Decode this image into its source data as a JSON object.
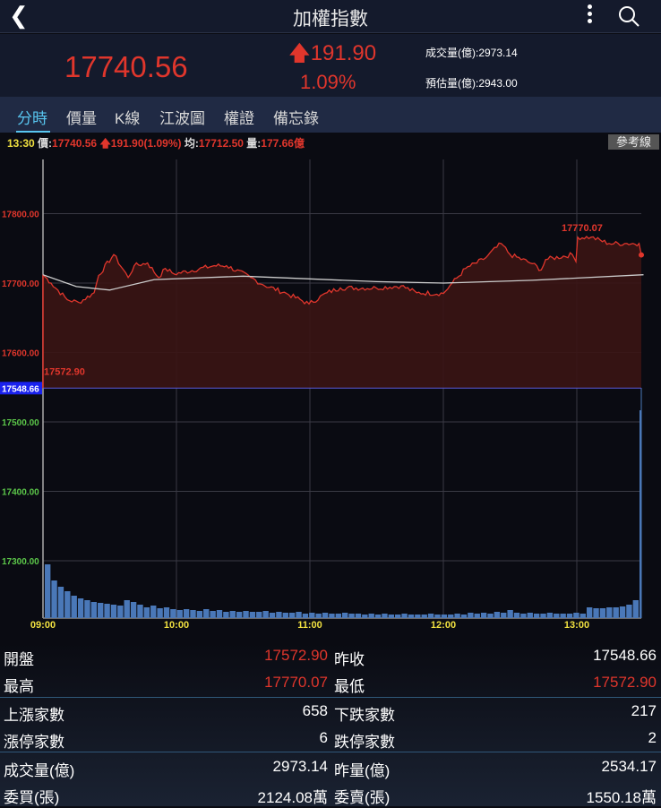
{
  "header": {
    "title": "加權指數",
    "back_icon": "chevron-left",
    "menu_icon": "more-vertical",
    "search_icon": "search"
  },
  "quote": {
    "price": "17740.56",
    "change": "191.90",
    "change_pct": "1.09%",
    "volume_label": "成交量(億):2973.14",
    "est_volume_label": "預估量(億):2943.00"
  },
  "tabs": [
    {
      "label": "分時",
      "active": true
    },
    {
      "label": "價量"
    },
    {
      "label": "K線"
    },
    {
      "label": "江波圖"
    },
    {
      "label": "權證"
    },
    {
      "label": "備忘錄"
    }
  ],
  "info": {
    "time": "13:30",
    "price_label": "價:",
    "price": "17740.56",
    "change": "191.90(1.09%)",
    "avg_label": "均:",
    "avg": "17712.50",
    "vol_label": "量:",
    "vol": "177.66億"
  },
  "ref_button": "參考線",
  "chart_data": {
    "type": "line",
    "prev_close": 17548.66,
    "prev_close_label": "17548.66",
    "high_label": "17770.07",
    "low_label": "17572.90",
    "y_ticks_upper": [
      "17800.00",
      "17700.00",
      "17600.00"
    ],
    "y_ticks_lower": [
      "17500.00",
      "17400.00",
      "17300.00"
    ],
    "x_ticks": [
      "09:00",
      "10:00",
      "11:00",
      "12:00",
      "13:00"
    ],
    "x_range_minutes": [
      0,
      270
    ],
    "price_series": [
      [
        0,
        17712
      ],
      [
        3.6,
        17700
      ],
      [
        10.9,
        17676
      ],
      [
        16.1,
        17672
      ],
      [
        23,
        17686
      ],
      [
        25,
        17711
      ],
      [
        31.8,
        17741
      ],
      [
        38.3,
        17708
      ],
      [
        41,
        17725
      ],
      [
        47,
        17729
      ],
      [
        52,
        17708
      ],
      [
        55,
        17721
      ],
      [
        59,
        17713
      ],
      [
        77,
        17725
      ],
      [
        82.5,
        17725
      ],
      [
        93.4,
        17708
      ],
      [
        98.7,
        17698
      ],
      [
        109.5,
        17685
      ],
      [
        119.6,
        17670
      ],
      [
        127.7,
        17686
      ],
      [
        133.7,
        17693
      ],
      [
        149.8,
        17693
      ],
      [
        161,
        17696
      ],
      [
        168,
        17686
      ],
      [
        180,
        17685
      ],
      [
        184,
        17700
      ],
      [
        190,
        17721
      ],
      [
        198,
        17734
      ],
      [
        206,
        17757
      ],
      [
        210,
        17741
      ],
      [
        220,
        17728
      ],
      [
        224,
        17719
      ],
      [
        226,
        17734
      ],
      [
        238,
        17741
      ],
      [
        239.6,
        17731
      ],
      [
        240.4,
        17766
      ],
      [
        246.4,
        17766
      ],
      [
        254.5,
        17757
      ],
      [
        262.5,
        17757
      ],
      [
        268,
        17757
      ],
      [
        269,
        17740.56
      ]
    ],
    "avg_series": [
      [
        0,
        17712
      ],
      [
        15,
        17695
      ],
      [
        30,
        17690
      ],
      [
        50,
        17705
      ],
      [
        90,
        17710
      ],
      [
        150,
        17702
      ],
      [
        180,
        17700
      ],
      [
        220,
        17704
      ],
      [
        270,
        17712
      ]
    ],
    "volume_relative": [
      60,
      42,
      35,
      30,
      25,
      22,
      20,
      18,
      17,
      16,
      15,
      14,
      20,
      18,
      15,
      12,
      14,
      11,
      12,
      10,
      9,
      10,
      9,
      8,
      10,
      8,
      9,
      7,
      8,
      7,
      8,
      7,
      7,
      8,
      6,
      7,
      6,
      6,
      7,
      5,
      6,
      5,
      6,
      5,
      5,
      6,
      5,
      5,
      4,
      5,
      4,
      5,
      4,
      4,
      5,
      4,
      4,
      4,
      5,
      4,
      4,
      4,
      5,
      4,
      6,
      5,
      6,
      5,
      7,
      6,
      9,
      6,
      5,
      6,
      5,
      5,
      6,
      5,
      5,
      5,
      6,
      5,
      12,
      11,
      11,
      12,
      12,
      13,
      15,
      20
    ]
  },
  "stats": [
    {
      "l1": "開盤",
      "v1": "17572.90",
      "l2": "昨收",
      "v2": "17548.66",
      "r1": true,
      "r2": false
    },
    {
      "l1": "最高",
      "v1": "17770.07",
      "l2": "最低",
      "v2": "17572.90",
      "r1": true,
      "r2": true
    },
    {
      "l1": "上漲家數",
      "v1": "658",
      "l2": "下跌家數",
      "v2": "217"
    },
    {
      "l1": "漲停家數",
      "v1": "6",
      "l2": "跌停家數",
      "v2": "2"
    },
    {
      "l1": "成交量(億)",
      "v1": "2973.14",
      "l2": "昨量(億)",
      "v2": "2534.17"
    },
    {
      "l1": "委買(張)",
      "v1": "2124.08萬",
      "l2": "委賣(張)",
      "v2": "1550.18萬"
    }
  ],
  "colors": {
    "up": "#e0362c",
    "accent": "#58c6f0",
    "time": "#f0e040",
    "lower_axis": "#5cc84a",
    "prev_close_bg": "#1a22ee",
    "volume": "#4a78b8"
  }
}
